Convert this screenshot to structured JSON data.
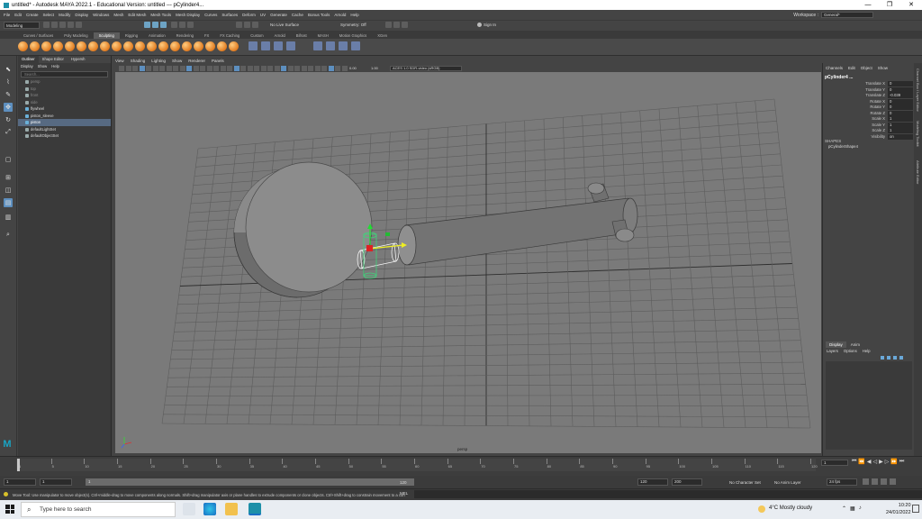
{
  "window": {
    "title": "untitled* - Autodesk MAYA 2022.1 - Educational Version: untitled   ---   pCylinder4...",
    "minimize": "—",
    "maximize": "❐",
    "close": "✕"
  },
  "menubar": {
    "items": [
      "File",
      "Edit",
      "Create",
      "Select",
      "Modify",
      "Display",
      "Windows",
      "Mesh",
      "Edit Mesh",
      "Mesh Tools",
      "Mesh Display",
      "Curves",
      "Surfaces",
      "Deform",
      "UV",
      "Generate",
      "Cache",
      "Bonus Tools",
      "Arnold",
      "Help"
    ],
    "workspace_label": "Workspace :",
    "workspace_value": "General*"
  },
  "statusline": {
    "mode": "Modeling",
    "no_live_surface": "No Live Surface",
    "symmetry": "Symmetry: Off",
    "sign_in": "Sign In"
  },
  "shelf": {
    "tabs": [
      "Curves / Surfaces",
      "Poly Modeling",
      "Sculpting",
      "Rigging",
      "Animation",
      "Rendering",
      "FX",
      "FX Caching",
      "Custom",
      "Arnold",
      "Bifrost",
      "MASH",
      "Motion Graphics",
      "XGen"
    ],
    "active_tab": "Sculpting"
  },
  "outliner": {
    "tabs": [
      "Outliner",
      "Shape Editor",
      "Hypersh"
    ],
    "menu": [
      "Display",
      "Show",
      "Help"
    ],
    "search_placeholder": "Search...",
    "items": [
      {
        "label": "persp",
        "dim": true
      },
      {
        "label": "top",
        "dim": true
      },
      {
        "label": "front",
        "dim": true
      },
      {
        "label": "side",
        "dim": true
      },
      {
        "label": "flywheel",
        "dim": false
      },
      {
        "label": "piston_sleeve",
        "dim": false
      },
      {
        "label": "piston",
        "dim": false
      },
      {
        "label": "defaultLightSet",
        "dim": false
      },
      {
        "label": "defaultObjectSet",
        "dim": false
      }
    ]
  },
  "viewport": {
    "menu": [
      "View",
      "Shading",
      "Lighting",
      "Show",
      "Renderer",
      "Panels"
    ],
    "near_value": "0.00",
    "far_value": "1.00",
    "color_space": "ACES 1.0 SDR-video (sRGB)",
    "camera_label": "persp"
  },
  "channelbox": {
    "menu": [
      "Channels",
      "Edit",
      "Object",
      "Show"
    ],
    "object_name": "pCylinder4 ...",
    "attributes": [
      {
        "label": "Translate X",
        "value": "0"
      },
      {
        "label": "Translate Y",
        "value": "0"
      },
      {
        "label": "Translate Z",
        "value": "-0.039"
      },
      {
        "label": "Rotate X",
        "value": "0"
      },
      {
        "label": "Rotate Y",
        "value": "0"
      },
      {
        "label": "Rotate Z",
        "value": "0"
      },
      {
        "label": "Scale X",
        "value": "1"
      },
      {
        "label": "Scale Y",
        "value": "1"
      },
      {
        "label": "Scale Z",
        "value": "1"
      },
      {
        "label": "Visibility",
        "value": "on"
      }
    ],
    "shapes_header": "SHAPES",
    "shape_name": "pCylinderShape4",
    "dock_tabs": [
      "Channel Box / Layer Editor",
      "Modeling Toolkit",
      "Attribute Editor"
    ]
  },
  "layers": {
    "tabs": [
      "Display",
      "Anim"
    ],
    "menu": [
      "Layers",
      "Options",
      "Help"
    ]
  },
  "timeline": {
    "current_frame": "1",
    "tick_labels": [
      "1",
      "5",
      "10",
      "15",
      "20",
      "25",
      "30",
      "35",
      "40",
      "45",
      "50",
      "55",
      "60",
      "65",
      "70",
      "75",
      "80",
      "85",
      "90",
      "95",
      "100",
      "105",
      "110",
      "115",
      "120"
    ],
    "range_start": "1",
    "playback_start": "1",
    "range_inner_start": "1",
    "range_inner_end": "120",
    "range_end": "120",
    "anim_end": "200",
    "character_set": "No Character Set",
    "anim_layer": "No Anim Layer",
    "fps": "24 fps"
  },
  "helpline": {
    "text": "Move Tool: Use manipulator to move object(s). Ctrl+middle-drag to move components along normals. Shift+drag manipulator axis or plane handles to extrude components or clone objects. Ctrl+Shift+drag to constrain movement to a con",
    "mel_label": "MEL"
  },
  "taskbar": {
    "search_placeholder": "Type here to search",
    "weather": "4°C  Mostly cloudy",
    "time": "10:20",
    "date": "24/01/2022"
  }
}
